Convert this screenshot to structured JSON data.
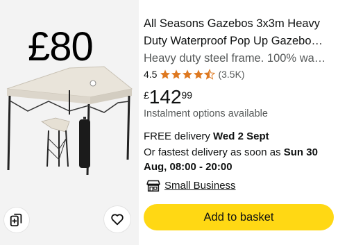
{
  "product": {
    "overlay_price": "£80",
    "title_line1": "All Seasons Gazebos 3x3m Heavy",
    "title_line2": "Duty Waterproof Pop Up Gazebo…",
    "subtitle": "Heavy duty steel frame. 100% wa…",
    "rating": {
      "value": "4.5",
      "stars": 4.5,
      "count": "(3.5K)",
      "star_color": "#de7921"
    },
    "price": {
      "symbol": "£",
      "whole": "142",
      "fraction": "99"
    },
    "instalment": "Instalment options available",
    "delivery": {
      "prefix": "FREE delivery ",
      "date": "Wed 2 Sept"
    },
    "fastest": {
      "prefix": "Or fastest delivery as soon as ",
      "date": "Sun 30 Aug, 08:00 - 20:00"
    },
    "small_business": "Small Business",
    "add_to_basket": "Add to basket"
  },
  "icons": {
    "compare": "compare-icon",
    "wishlist": "heart-icon",
    "store": "store-icon",
    "star": "star-icon"
  },
  "colors": {
    "button": "#ffd814",
    "media_bg": "#f3f3f3",
    "muted_text": "#565959"
  }
}
